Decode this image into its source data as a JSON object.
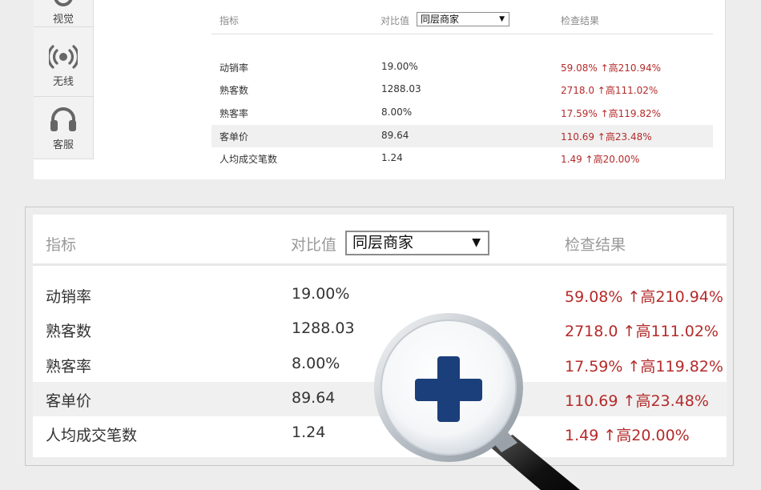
{
  "sidebar": {
    "items": [
      {
        "label": "视觉",
        "icon": "eye-icon"
      },
      {
        "label": "无线",
        "icon": "wireless-icon"
      },
      {
        "label": "客服",
        "icon": "headset-icon"
      }
    ]
  },
  "table": {
    "headers": {
      "metric": "指标",
      "compare": "对比值",
      "result": "检查结果"
    },
    "select": {
      "value": "同层商家"
    },
    "rows": [
      {
        "metric": "动销率",
        "compare": "19.00%",
        "result": "59.08% ↑高210.94%"
      },
      {
        "metric": "熟客数",
        "compare": "1288.03",
        "result": "2718.0 ↑高111.02%"
      },
      {
        "metric": "熟客率",
        "compare": "8.00%",
        "result": "17.59% ↑高119.82%"
      },
      {
        "metric": "客单价",
        "compare": "89.64",
        "result": "110.69 ↑高23.48%"
      },
      {
        "metric": "人均成交笔数",
        "compare": "1.24",
        "result": "1.49 ↑高20.00%"
      }
    ]
  },
  "magnifier": {
    "icon": "magnifier-plus-icon"
  },
  "colors": {
    "result_red": "#b52a2a",
    "header_gray": "#8a8a8a",
    "zebra": "#f0f0f0",
    "plus_blue": "#1b3f7a"
  }
}
